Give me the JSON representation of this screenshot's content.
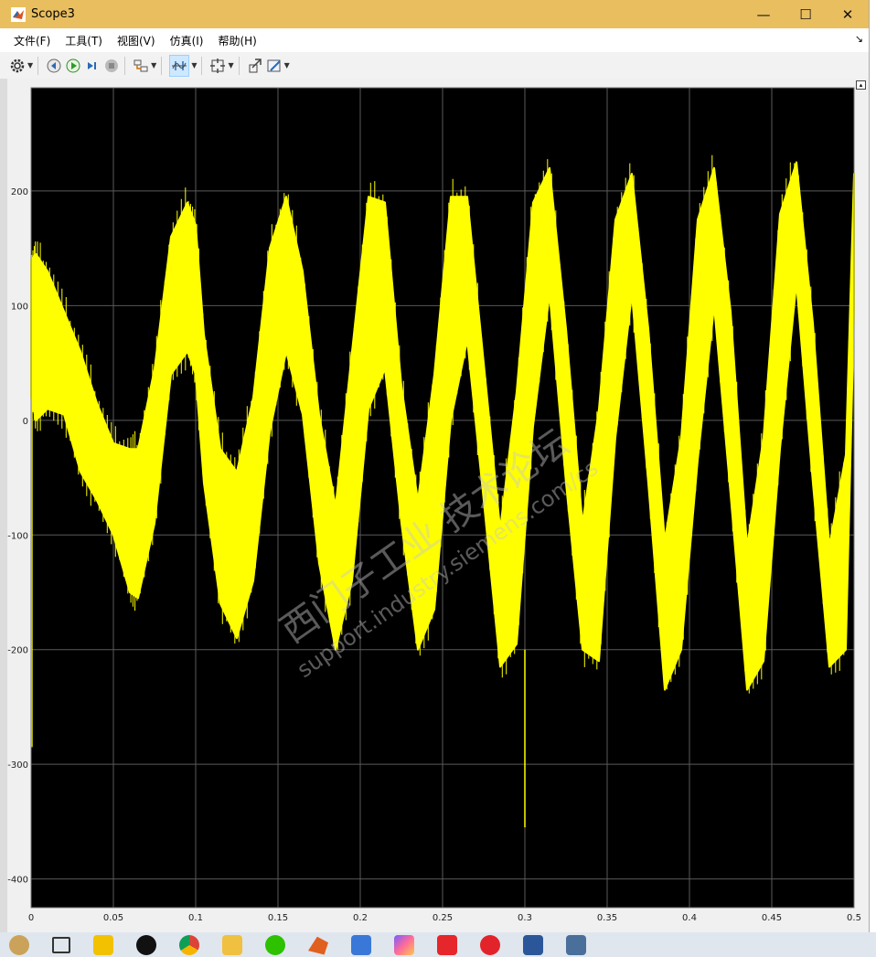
{
  "window": {
    "title": "Scope3",
    "controls": [
      "—",
      "☐",
      "✕"
    ]
  },
  "menu": {
    "items": [
      "文件(F)",
      "工具(T)",
      "视图(V)",
      "仿真(I)",
      "帮助(H)"
    ],
    "overflow": "↘"
  },
  "toolbar": {
    "icons": [
      "gear-icon",
      "step-back-icon",
      "run-icon",
      "step-forward-icon",
      "stop-icon",
      "signal-select-icon",
      "cursor-measure-icon",
      "zoom-fit-icon",
      "highlight-block-icon",
      "style-icon"
    ]
  },
  "colors": {
    "plot_background": "#000000",
    "signal": "#ffff00",
    "grid": "#5a5a5a",
    "axes_background": "#f0f0f0"
  },
  "watermark": {
    "line1": "西门子工业 技术论坛",
    "line2": "support.industry.siemens.com/cs"
  },
  "chart_data": {
    "type": "line",
    "xlim": [
      0,
      0.5
    ],
    "ylim": [
      -425,
      290
    ],
    "xticks": [
      0,
      0.05,
      0.1,
      0.15,
      0.2,
      0.25,
      0.3,
      0.35,
      0.4,
      0.45,
      0.5
    ],
    "xtick_labels": [
      "0",
      "0.05",
      "0.1",
      "0.15",
      "0.2",
      "0.25",
      "0.3",
      "0.35",
      "0.4",
      "0.45",
      "0.5"
    ],
    "yticks": [
      -400,
      -300,
      -200,
      -100,
      0,
      100,
      200
    ],
    "ytick_labels": [
      "-400",
      "-300",
      "-200",
      "-100",
      "0",
      "100",
      "200"
    ],
    "grid": true,
    "envelope": {
      "x": [
        0,
        0.003,
        0.01,
        0.02,
        0.03,
        0.04,
        0.05,
        0.06,
        0.065,
        0.075,
        0.085,
        0.095,
        0.1,
        0.105,
        0.115,
        0.125,
        0.135,
        0.145,
        0.155,
        0.165,
        0.175,
        0.185,
        0.195,
        0.205,
        0.215,
        0.225,
        0.235,
        0.245,
        0.255,
        0.265,
        0.275,
        0.285,
        0.295,
        0.305,
        0.315,
        0.325,
        0.335,
        0.345,
        0.355,
        0.365,
        0.375,
        0.385,
        0.395,
        0.405,
        0.415,
        0.425,
        0.435,
        0.445,
        0.455,
        0.465,
        0.475,
        0.485,
        0.495,
        0.5
      ],
      "upper": [
        140,
        145,
        130,
        95,
        60,
        15,
        -20,
        -25,
        -25,
        45,
        160,
        190,
        170,
        75,
        -25,
        -45,
        20,
        150,
        195,
        130,
        5,
        -75,
        60,
        195,
        190,
        30,
        -70,
        40,
        195,
        195,
        50,
        -95,
        25,
        190,
        220,
        80,
        -90,
        10,
        175,
        215,
        80,
        -105,
        -15,
        175,
        220,
        95,
        -110,
        -15,
        180,
        225,
        85,
        -110,
        -30,
        215
      ],
      "lower": [
        20,
        0,
        10,
        5,
        -45,
        -70,
        -100,
        -150,
        -155,
        -90,
        40,
        60,
        40,
        -55,
        -160,
        -190,
        -140,
        -10,
        60,
        5,
        -125,
        -200,
        -140,
        10,
        45,
        -90,
        -200,
        -165,
        0,
        70,
        -70,
        -215,
        -195,
        -5,
        110,
        -55,
        -200,
        -210,
        -15,
        110,
        -55,
        -235,
        -200,
        -35,
        100,
        -65,
        -235,
        -210,
        -25,
        120,
        -55,
        -215,
        -200,
        95
      ]
    },
    "spikes": [
      {
        "x": 0.0005,
        "y": [
          -285,
          140
        ]
      },
      {
        "x": 0.3,
        "y": [
          -355,
          -200
        ]
      }
    ]
  }
}
